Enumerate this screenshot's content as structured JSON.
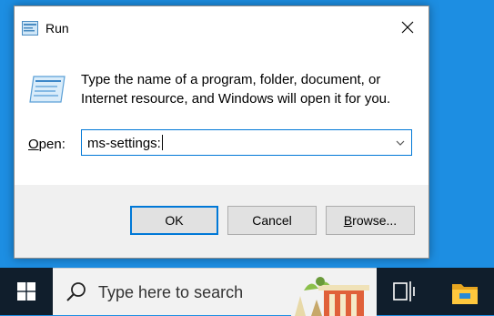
{
  "dialog": {
    "title": "Run",
    "description": "Type the name of a program, folder, document, or Internet resource, and Windows will open it for you.",
    "open_label_prefix": "O",
    "open_label_rest": "pen:",
    "command_value": "ms-settings:",
    "buttons": {
      "ok": "OK",
      "cancel": "Cancel",
      "browse_prefix": "B",
      "browse_rest": "rowse..."
    }
  },
  "taskbar": {
    "search_placeholder": "Type here to search"
  },
  "colors": {
    "desktop": "#1d8ee2",
    "accent": "#0078d7",
    "footer": "#f0f0f0",
    "taskbar": "#101e2c"
  },
  "icons": [
    "run-icon",
    "close-icon",
    "run-program-icon",
    "chevron-down-icon",
    "windows-start-icon",
    "search-icon",
    "task-view-icon",
    "file-explorer-icon"
  ]
}
